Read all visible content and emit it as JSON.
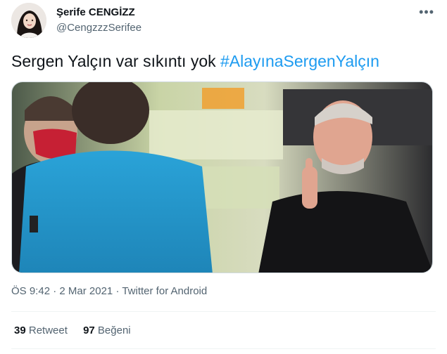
{
  "author": {
    "display_name": "Şerife CENGİZZ",
    "handle": "@CengzzzSerifee"
  },
  "tweet": {
    "text_plain": "Sergen Yalçın var sıkıntı yok ",
    "hashtag": "#AlayınaSergenYalçın"
  },
  "meta": {
    "time": "ÖS 9:42",
    "dot1": " · ",
    "date": "2 Mar 2021",
    "dot2": " · ",
    "source": "Twitter for Android"
  },
  "stats": {
    "retweets_count": "39",
    "retweets_label": "Retweet",
    "likes_count": "97",
    "likes_label": "Beğeni"
  },
  "icons": {
    "more": "more-dots-icon"
  }
}
